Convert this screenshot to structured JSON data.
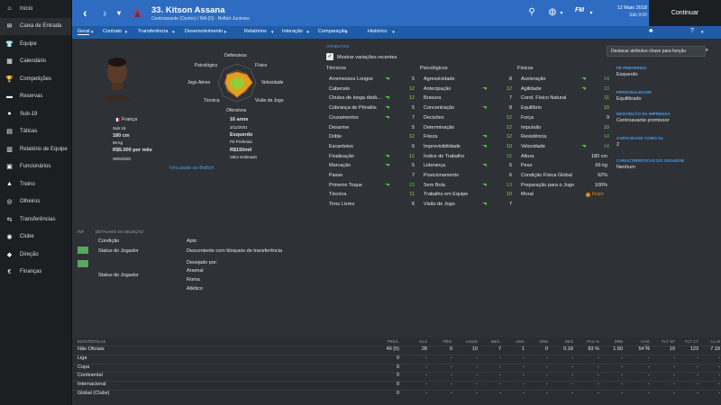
{
  "sidebar": {
    "items": [
      {
        "label": "Início",
        "icon": "home-icon",
        "glyph": "⌂"
      },
      {
        "label": "Caixa de Entrada",
        "icon": "inbox-icon",
        "glyph": "✉"
      },
      {
        "label": "Equipe",
        "icon": "team-icon",
        "glyph": "👕"
      },
      {
        "label": "Calendário",
        "icon": "calendar-icon",
        "glyph": "▦"
      },
      {
        "label": "Competições",
        "icon": "trophy-icon",
        "glyph": "🏆"
      },
      {
        "label": "Reservas",
        "icon": "reserves-icon",
        "glyph": "▬"
      },
      {
        "label": "Sub-19",
        "icon": "youth-icon",
        "glyph": "●"
      },
      {
        "label": "Táticas",
        "icon": "tactics-icon",
        "glyph": "▤"
      },
      {
        "label": "Relatório de Equipe",
        "icon": "report-icon",
        "glyph": "▥"
      },
      {
        "label": "Funcionários",
        "icon": "staff-icon",
        "glyph": "▣"
      },
      {
        "label": "Treino",
        "icon": "training-icon",
        "glyph": "▲"
      },
      {
        "label": "Olheiros",
        "icon": "scouting-icon",
        "glyph": "◎"
      },
      {
        "label": "Transferências",
        "icon": "transfers-icon",
        "glyph": "⇆"
      },
      {
        "label": "Clube",
        "icon": "club-icon",
        "glyph": "◉"
      },
      {
        "label": "Direção",
        "icon": "board-icon",
        "glyph": "◆"
      },
      {
        "label": "Finanças",
        "icon": "finance-icon",
        "glyph": "€"
      }
    ]
  },
  "header": {
    "title": "33. Kitson Assana",
    "subtitle": "Centroavante (Centro) / MA (D) - Belfort Juniores",
    "date": "12 Maio 2018",
    "day": "Sáb 9:00",
    "continue": "Continuar",
    "fm": "FM"
  },
  "tabs": [
    "Geral",
    "Contrato",
    "Transferência",
    "Desenvolvimento",
    "Relatórios",
    "Interação",
    "Comparação",
    "Histórico"
  ],
  "radar": {
    "top": "Defensivos",
    "left_top": "Psicológico",
    "right_top": "Físico",
    "left": "Jogo Aéreo",
    "right": "Velocidade",
    "left_bottom": "Técnica",
    "right_bottom": "Visão de Jogo",
    "bottom": "Ofensivos"
  },
  "profile": {
    "nation": "França",
    "col1": [
      "Sub 19",
      "180 cm",
      "66 kg",
      "R$5.000 por mês",
      "30/6/2020"
    ],
    "col2": [
      "16 anos",
      "3/11/2001",
      "Esquerdo",
      "Pé Preferido",
      "R$150mil",
      "Valor Estimado"
    ],
    "link": "Vinculado ao Belfort"
  },
  "attrs": {
    "heading": "ATRIBUTOS",
    "show_changes": "Mostrar variações recentes",
    "highlight_btn": "Destacar atributos chave para função",
    "tec_title": "Técnicos",
    "psy_title": "Psicológicos",
    "fis_title": "Físicos",
    "tec": [
      [
        "Arremessos Longos",
        "5",
        true
      ],
      [
        "Cabeceio",
        "12",
        false
      ],
      [
        "Chutes de longa distâ...",
        "12",
        true
      ],
      [
        "Cobrança de Pênaltis",
        "5",
        true
      ],
      [
        "Cruzamentos",
        "7",
        true
      ],
      [
        "Desarme",
        "5",
        false
      ],
      [
        "Drible",
        "12",
        false
      ],
      [
        "Escanteios",
        "6",
        false
      ],
      [
        "Finalização",
        "12",
        true
      ],
      [
        "Marcação",
        "5",
        true
      ],
      [
        "Passe",
        "7",
        false
      ],
      [
        "Primeiro Toque",
        "15",
        true
      ],
      [
        "Técnica",
        "11",
        false
      ],
      [
        "Tiros Livres",
        "6",
        false
      ]
    ],
    "psy": [
      [
        "Agressividade",
        "8",
        false
      ],
      [
        "Antecipação",
        "12",
        true
      ],
      [
        "Bravura",
        "7",
        false
      ],
      [
        "Concentração",
        "8",
        true
      ],
      [
        "Decisões",
        "12",
        false
      ],
      [
        "Determinação",
        "12",
        false
      ],
      [
        "Frieza",
        "12",
        true
      ],
      [
        "Imprevisibilidade",
        "10",
        true
      ],
      [
        "Índice de Trabalho",
        "15",
        false
      ],
      [
        "Liderança",
        "5",
        true
      ],
      [
        "Posicionamento",
        "6",
        false
      ],
      [
        "Sem Bola",
        "13",
        true
      ],
      [
        "Trabalho em Equipe",
        "10",
        false
      ],
      [
        "Visão de Jogo",
        "7",
        true
      ]
    ],
    "fis": [
      [
        "Aceleração",
        "14",
        true
      ],
      [
        "Agilidade",
        "13",
        true
      ],
      [
        "Cond. Físico Natural",
        "11",
        false
      ],
      [
        "Equilíbrio",
        "10",
        false
      ],
      [
        "Força",
        "9",
        false
      ],
      [
        "Impulsão",
        "10",
        false
      ],
      [
        "Resistência",
        "14",
        false
      ],
      [
        "Velocidade",
        "14",
        true
      ]
    ],
    "extra": [
      [
        "Altura",
        "180 cm"
      ],
      [
        "Peso",
        "66 kg"
      ],
      [
        "Condição Física Global",
        "92%"
      ],
      [
        "Preparação para o Jogo",
        "100%"
      ],
      [
        "Moral",
        "Ruim"
      ]
    ]
  },
  "right_info": [
    [
      "PÉ PREFERIDO",
      "Esquerdo"
    ],
    [
      "PERSONALIDADE",
      "Equilibrado"
    ],
    [
      "DESCRIÇÃO NA IMPRENSA",
      "Centroavante promissor"
    ],
    [
      "CAPACIDADE COMO GL",
      "2"
    ],
    [
      "CARACTERÍSTICAS DO JOGADOR",
      "Nenhum"
    ]
  ],
  "selection": {
    "inf": "INF",
    "heading": "DETALHES DA SELEÇÃO",
    "rows": [
      [
        "Condição",
        "Apto"
      ],
      [
        "Status do Jogador",
        "Descontente com bloqueio de transferência"
      ],
      [
        "Status do Jogador",
        "Desejado por:"
      ]
    ],
    "clubs": [
      "Arsenal",
      "Roma",
      "Atlético"
    ]
  },
  "stats": {
    "heading": "ESTATÍSTICAS",
    "cols": [
      "PRES.",
      "GLS",
      "PÊN.",
      "ASSIS",
      "MEC.",
      "AMA",
      "VRM",
      "DES",
      "PAS %",
      "DRB",
      "CHG FU",
      "FLT SF",
      "FLT CT",
      "CL M"
    ],
    "rows": [
      [
        "Não Oficiais",
        "49 (5)",
        "28",
        "0",
        "10",
        "7",
        "1",
        "0",
        "0.18",
        "83 %",
        "1.50",
        "54 %",
        "19",
        "123",
        "7.18"
      ],
      [
        "Liga",
        "0",
        "-",
        "-",
        "-",
        "-",
        "-",
        "-",
        "-",
        "-",
        "-",
        "-",
        "-",
        "-",
        "-"
      ],
      [
        "Copa",
        "0",
        "-",
        "-",
        "-",
        "-",
        "-",
        "-",
        "-",
        "-",
        "-",
        "-",
        "-",
        "-",
        "-"
      ],
      [
        "Continental",
        "0",
        "-",
        "-",
        "-",
        "-",
        "-",
        "-",
        "-",
        "-",
        "-",
        "-",
        "-",
        "-",
        "-"
      ],
      [
        "Internacional",
        "0",
        "-",
        "-",
        "-",
        "-",
        "-",
        "-",
        "-",
        "-",
        "-",
        "-",
        "-",
        "-",
        "-"
      ],
      [
        "Global (Clube)",
        "0",
        "-",
        "-",
        "-",
        "-",
        "-",
        "-",
        "-",
        "-",
        "-",
        "-",
        "-",
        "-",
        "-"
      ]
    ]
  }
}
